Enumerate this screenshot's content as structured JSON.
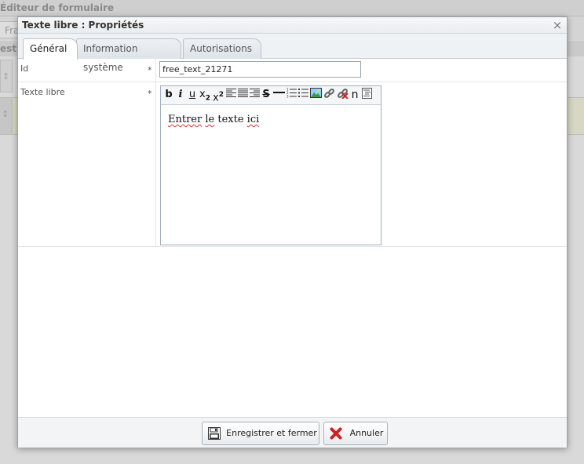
{
  "background": {
    "title": "Éditeur de formulaire",
    "tab_fragment": "Fra",
    "header_fragment": "est"
  },
  "dialog": {
    "title": "Texte libre : Propriétés",
    "close_glyph": "×"
  },
  "tabs": [
    {
      "label": "Général",
      "active": true
    },
    {
      "label": "Information système",
      "active": false
    },
    {
      "label": "Autorisations",
      "active": false
    }
  ],
  "form": {
    "id_label": "Id",
    "id_required": "*",
    "id_value": "free_text_21271",
    "text_label": "Texte libre",
    "text_required": "*",
    "editor_content": {
      "word1": "Entrer",
      "word2": "le",
      "word3": "texte",
      "word4": "ici"
    },
    "toolbar": {
      "bold": "b",
      "italic": "i",
      "underline": "u",
      "subscript": "x",
      "subscript_mark": "2",
      "superscript": "x",
      "superscript_mark": "2",
      "strike": "S",
      "special_char": "n"
    }
  },
  "footer": {
    "save_label": "Enregistrer et fermer",
    "cancel_label": "Annuler"
  },
  "colors": {
    "accent_cancel": "#cc2222",
    "editor_border": "#9fb0bd"
  }
}
